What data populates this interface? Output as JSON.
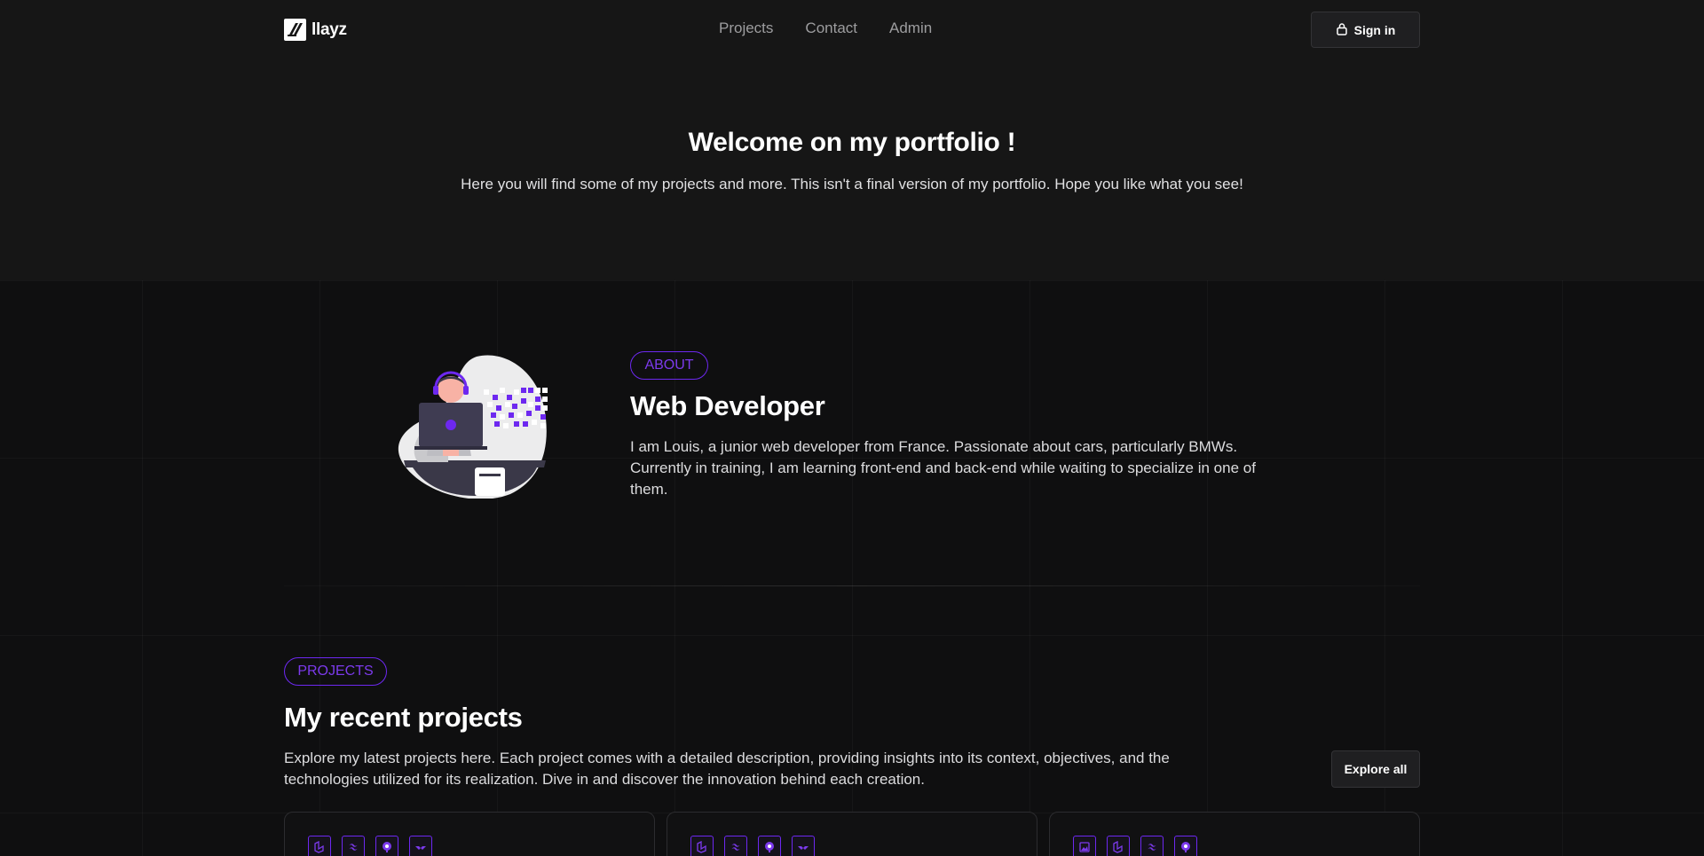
{
  "header": {
    "brand": "llayz",
    "nav": [
      {
        "label": "Projects"
      },
      {
        "label": "Contact"
      },
      {
        "label": "Admin"
      }
    ],
    "signin_label": "Sign in"
  },
  "hero": {
    "title": "Welcome on my portfolio !",
    "subtitle": "Here you will find some of my projects and more. This isn't a final version of my portfolio. Hope you like what you see!"
  },
  "about": {
    "badge": "ABOUT",
    "title": "Web Developer",
    "text": "I am Louis, a junior web developer from France. Passionate about cars, particularly BMWs. Currently in training, I am learning front-end and back-end while waiting to specialize in one of them."
  },
  "projects": {
    "badge": "PROJECTS",
    "title": "My recent projects",
    "text": "Explore my latest projects here. Each project comes with a detailed description, providing insights into its context, objectives, and the technologies utilized for its realization. Dive in and discover the innovation behind each creation.",
    "explore_label": "Explore all",
    "cards": [
      {
        "icons": [
          "laravel-icon",
          "tailwind-icon",
          "php-icon",
          "alpine-icon"
        ]
      },
      {
        "icons": [
          "laravel-icon",
          "tailwind-icon",
          "php-icon",
          "alpine-icon"
        ]
      },
      {
        "icons": [
          "image-icon",
          "laravel-icon",
          "tailwind-icon",
          "php-icon"
        ]
      }
    ]
  },
  "colors": {
    "accent": "#6d28f0",
    "background": "#161616",
    "section_background": "#0f0f10"
  }
}
